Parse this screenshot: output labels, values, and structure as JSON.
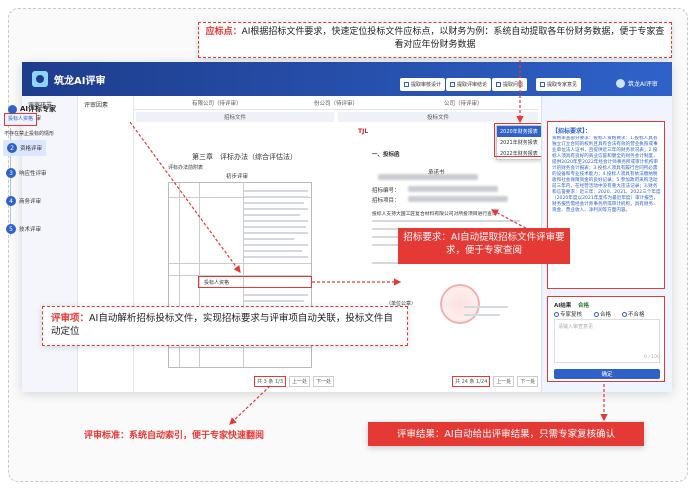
{
  "app": {
    "title": "筑龙AI评审",
    "user": "筑龙AI评审"
  },
  "toolbar": {
    "btn1": "提取审核设计",
    "btn2": "提取评审结论",
    "btn3": "提取问题",
    "btn4": "提取专家意见"
  },
  "sidebar": {
    "header": "评审环节",
    "items": [
      {
        "num": "1",
        "label": "形式评审"
      },
      {
        "num": "2",
        "label": "资格评审"
      },
      {
        "num": "3",
        "label": "响应性评审"
      },
      {
        "num": "4",
        "label": "商务评审"
      },
      {
        "num": "5",
        "label": "技术评审"
      }
    ]
  },
  "col2": {
    "header": "评审因素",
    "active_item": "投标人资格",
    "item2": "不存在禁止投标的情形"
  },
  "doc_tabs": {
    "tab1": "有限公司（待评审）",
    "tab2": "份公司（待评审）",
    "tab3": "公司（待评审）"
  },
  "left_doc": {
    "header": "招标文件",
    "chapter": "第三章　评标办法（综合评估法）",
    "subtitle": "评标办法前附表",
    "section": "初步评审",
    "hl_label": "投标人资格",
    "pager": {
      "total": "共 3 条",
      "page": "1/3",
      "prev": "上一处",
      "next": "下一处"
    }
  },
  "right_doc": {
    "header": "投标文件",
    "logo": "TJL",
    "section": "一、投标函",
    "line1": "承诺书",
    "field1": "招标编号：",
    "field2": "招标项目：",
    "body": "投标人支持大国工匠复合材料有限公司对所投项目进行查询",
    "seal_label": "（单位公章）",
    "pager": {
      "total": "共 24 条",
      "page": "1/24",
      "prev": "上一处",
      "next": "下一处"
    }
  },
  "year_dropdown": {
    "options": [
      "2020年财务报表",
      "2021年财务报表",
      "2022年财务报表"
    ],
    "selected_index": 0
  },
  "expert": {
    "title": "AI评标专家",
    "box_title": "【招标要求】：",
    "body": "资格审查部分要求：投标人资格要求：1.投标人具有独立订立合同的权利且具有合法有效的营业执照或事业单位法人证书，且提供近三年的财务状况表；2.投标人须具有良好的商业信誉和健全的财务会计制度，提供2020年至2022年经会计师事务所或审计机构审计的财务会计报表；3.投标人须具有履行合同所必需的设备和专业技术能力；4.投标人须具有依法缴纳税收和社会保障资金的良好记录；5.参加政府采购活动前三年内，在经营活动中没有重大违法记录；3.财务和信誉要求：近三年：2020、2021、2022三个年度（2020年度以2021年度作为最近年度）审计报告，财务报告需经会计师事务所或审计机构，具有财务、资金、营业收入、净利润等方面内容。",
    "result": {
      "title": "AI结果",
      "badge": "合格",
      "q_label": "专家复核",
      "opt1": "合格",
      "opt2": "不合格",
      "placeholder": "请输入审查意见",
      "counter": "0 / 100",
      "submit": "确定"
    }
  },
  "callouts": {
    "top_label": "应标点：",
    "top_text": "AI根据招标文件要求，快速定位投标文件应标点，以财务为例：系统自动提取各年份财务数据，便于专家查看对应年份财务数据",
    "left_label": "评审项：",
    "left_text": "AI自动解析招标投标文件，实现招标要求与评审项自动关联，投标文件自动定位",
    "mid_text": "招标要求：AI自动提取招标文件评审要求，便于专家查阅",
    "bot_left": "评审标准：系统自动索引，便于专家快速翻阅",
    "bot_right": "评审结果：AI自动给出评审结果，只需专家复核确认"
  }
}
